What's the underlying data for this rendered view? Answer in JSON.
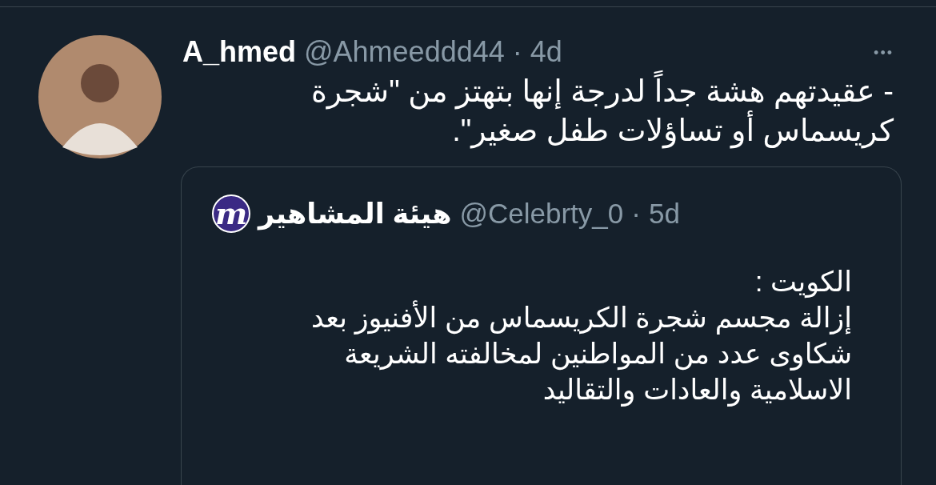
{
  "tweet": {
    "display_name": "A_hmed",
    "handle": "@Ahmeeddd44",
    "separator": "·",
    "time": "4d",
    "more": "•••",
    "text_lines": [
      "- عقيدتهم هشة جداً لدرجة إنها بتهتز من \"شجرة",
      "كريسماس أو تساؤلات طفل صغير\"."
    ],
    "quote": {
      "logo_letter": "m",
      "display_name": "هيئة المشاهير",
      "handle": "@Celebrty_0",
      "separator": "·",
      "time": "5d",
      "text_lines": [
        "الكويت :",
        "إزالة مجسم شجرة الكريسماس من الأفنيوز بعد",
        "شكاوى عدد من المواطنين لمخالفته الشريعة",
        "الاسلامية والعادات والتقاليد"
      ]
    }
  }
}
